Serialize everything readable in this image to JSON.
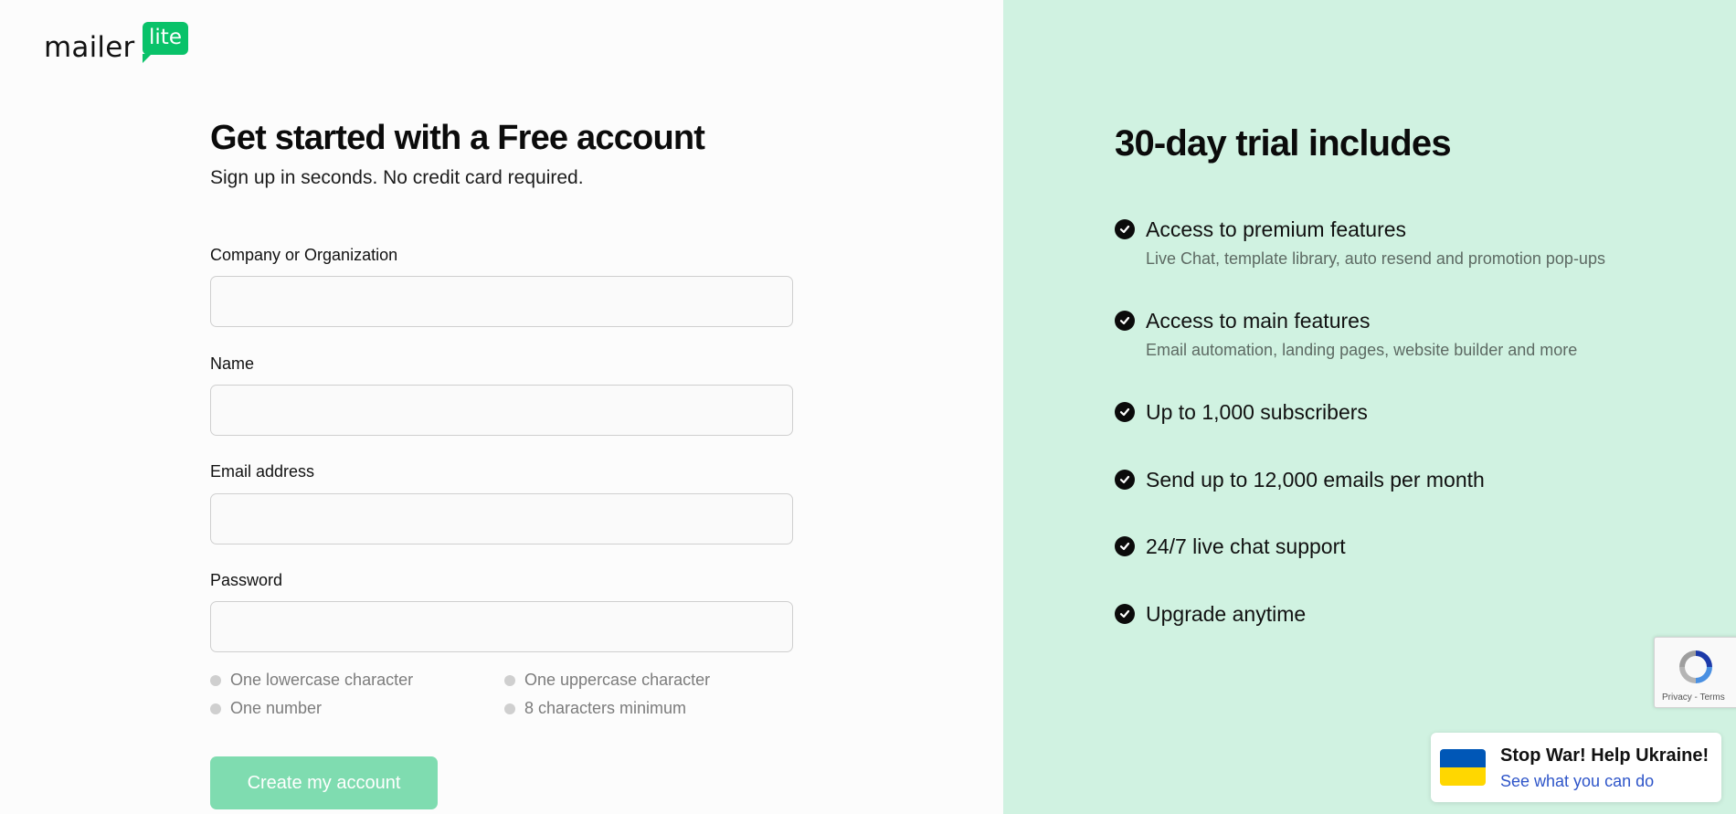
{
  "logo": {
    "word": "mailer",
    "badge": "lite",
    "brand_color": "#09c269"
  },
  "form": {
    "title": "Get started with a Free account",
    "subtitle": "Sign up in seconds. No credit card required.",
    "fields": [
      {
        "label": "Company or Organization",
        "value": ""
      },
      {
        "label": "Name",
        "value": ""
      },
      {
        "label": "Email address",
        "value": ""
      },
      {
        "label": "Password",
        "value": ""
      }
    ],
    "password_rules": [
      "One lowercase character",
      "One uppercase character",
      "One number",
      "8 characters minimum"
    ],
    "submit_label": "Create my account",
    "submit_color": "#7fdcb0"
  },
  "trial": {
    "title": "30-day trial includes",
    "features": [
      {
        "title": "Access to premium features",
        "desc": "Live Chat, template library, auto resend and promotion pop-ups"
      },
      {
        "title": "Access to main features",
        "desc": "Email automation, landing pages, website builder and more"
      },
      {
        "title": "Up to 1,000 subscribers"
      },
      {
        "title": "Send up to 12,000 emails per month"
      },
      {
        "title": "24/7 live chat support"
      },
      {
        "title": "Upgrade anytime"
      }
    ],
    "background": "#d0f2e1"
  },
  "recaptcha": {
    "text": "Privacy - Terms"
  },
  "ukraine_banner": {
    "title": "Stop War! Help Ukraine!",
    "link": "See what you can do"
  }
}
